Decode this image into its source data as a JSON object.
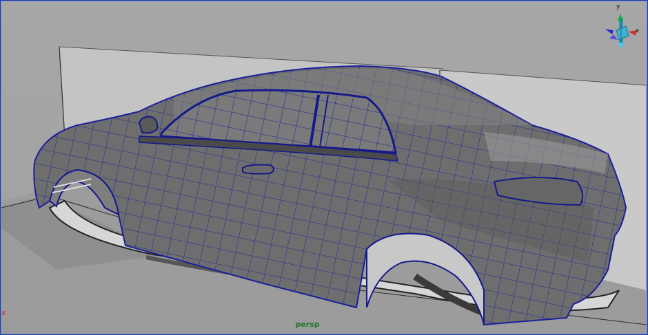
{
  "viewport": {
    "camera_name": "persp",
    "background_color": "#a4a4a4",
    "wire_color": "#1a1f9a",
    "axis": {
      "y_label": "y",
      "x_label": "x"
    },
    "corner_marker": "x"
  }
}
